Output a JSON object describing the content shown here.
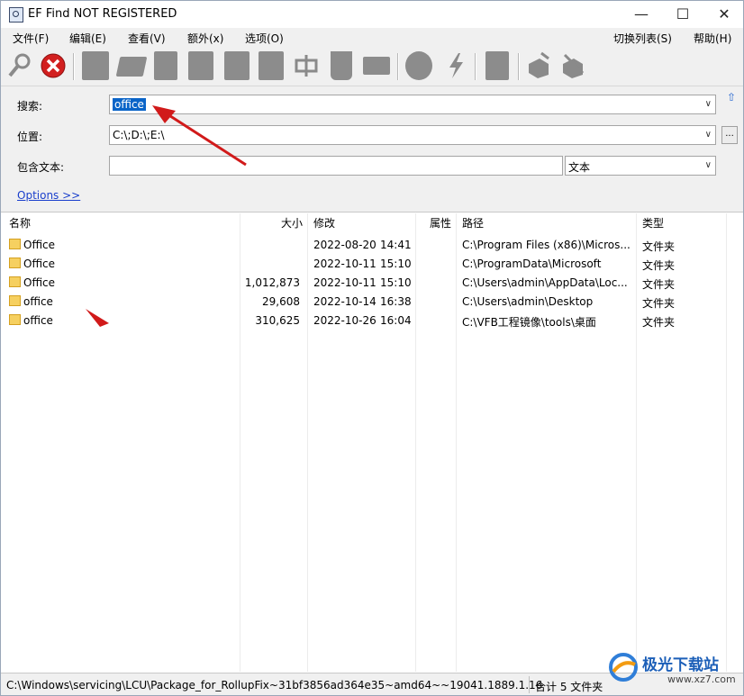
{
  "window": {
    "title": "EF Find NOT REGISTERED",
    "controls": {
      "minimize": "—",
      "maximize": "☐",
      "close": "✕"
    }
  },
  "menu": {
    "file": "文件(F)",
    "edit": "编辑(E)",
    "view": "查看(V)",
    "extra": "额外(x)",
    "options": "选项(O)",
    "switch_list": "切换列表(S)",
    "help": "帮助(H)"
  },
  "toolbar": {
    "icons": [
      "search-icon",
      "stop-icon",
      "new-icon",
      "rename-icon",
      "document-icon",
      "edit-icon",
      "copy-icon",
      "duplicate-icon",
      "compress-icon",
      "delete-icon",
      "convert-icon",
      "sphere-icon",
      "flash-icon",
      "properties-icon",
      "tools-icon",
      "settings-icon"
    ]
  },
  "form": {
    "search_label": "搜索:",
    "search_value": "office",
    "location_label": "位置:",
    "location_value": "C:\\;D:\\;E:\\",
    "browse_label": "...",
    "contains_label": "包含文本:",
    "contains_value": "",
    "contains_mode": "文本",
    "options_link": "Options  >>",
    "up_icon": "⇧"
  },
  "table": {
    "headers": {
      "name": "名称",
      "size": "大小",
      "modified": "修改",
      "attr": "属性",
      "path": "路径",
      "type": "类型"
    },
    "rows": [
      {
        "name": "Office",
        "size": "",
        "date": "2022-08-20",
        "time": "14:41",
        "attr": "",
        "path": "C:\\Program Files (x86)\\Micros...",
        "type": "文件夹"
      },
      {
        "name": "Office",
        "size": "",
        "date": "2022-10-11",
        "time": "15:10",
        "attr": "",
        "path": "C:\\ProgramData\\Microsoft",
        "type": "文件夹"
      },
      {
        "name": "Office",
        "size": "1,012,873",
        "date": "2022-10-11",
        "time": "15:10",
        "attr": "",
        "path": "C:\\Users\\admin\\AppData\\Loc...",
        "type": "文件夹"
      },
      {
        "name": "office",
        "size": "29,608",
        "date": "2022-10-14",
        "time": "16:38",
        "attr": "",
        "path": "C:\\Users\\admin\\Desktop",
        "type": "文件夹"
      },
      {
        "name": "office",
        "size": "310,625",
        "date": "2022-10-26",
        "time": "16:04",
        "attr": "",
        "path": "C:\\VFB工程镜像\\tools\\桌面",
        "type": "文件夹"
      }
    ]
  },
  "status": {
    "path": "C:\\Windows\\servicing\\LCU\\Package_for_RollupFix~31bf3856ad364e35~amd64~~19041.1889.1.16",
    "count": "合计 5 文件夹"
  },
  "watermark": {
    "text": "极光下载站",
    "url": "www.xz7.com"
  },
  "colors": {
    "arrow": "#d11a1a",
    "selection": "#0a64c8",
    "link": "#1a3fcc"
  }
}
